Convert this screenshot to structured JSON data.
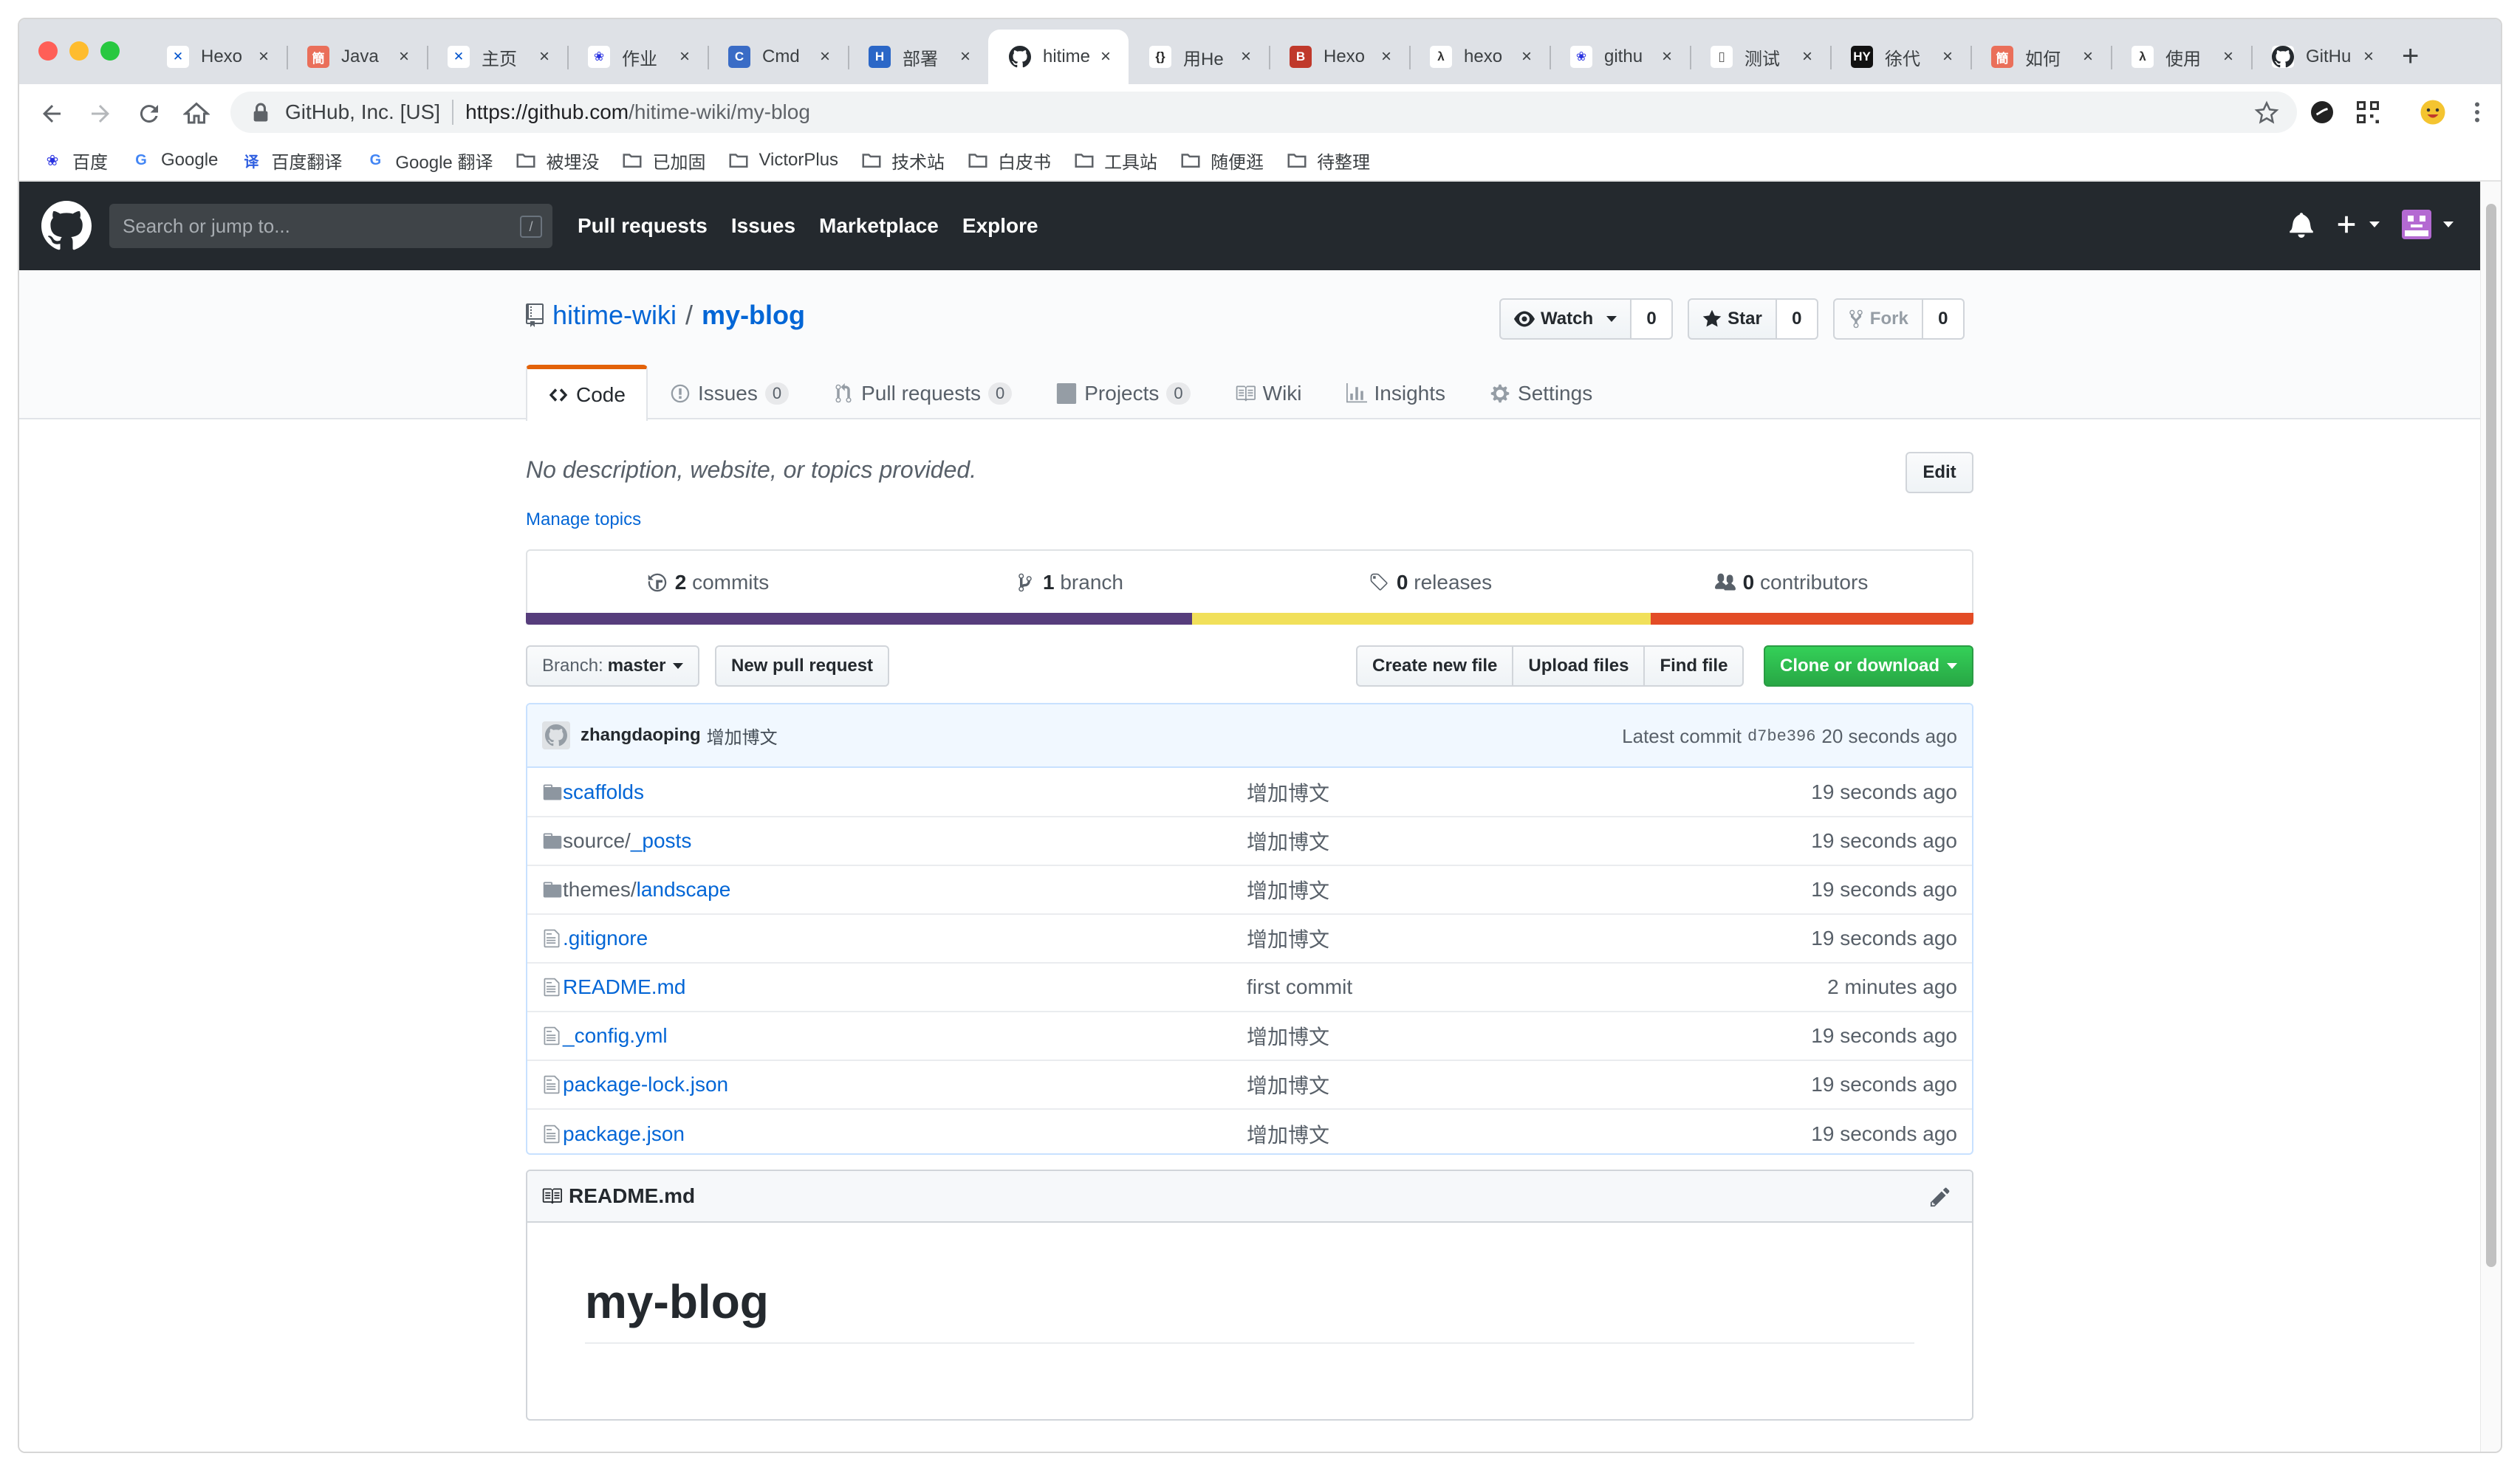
{
  "browser": {
    "tabs": [
      {
        "title": "Hexo",
        "favicon": "confluence-icon",
        "bg": "#ffffff",
        "fg": "#0052cc",
        "glyph": "✕"
      },
      {
        "title": "Java",
        "favicon": "jianshu-icon",
        "bg": "#ea6f5a",
        "fg": "#ffffff",
        "glyph": "簡"
      },
      {
        "title": "主页",
        "favicon": "confluence-icon",
        "bg": "#ffffff",
        "fg": "#0052cc",
        "glyph": "✕"
      },
      {
        "title": "作业",
        "favicon": "baidu-paw-icon",
        "bg": "#ffffff",
        "fg": "#2932e1",
        "glyph": "❀"
      },
      {
        "title": "Cmd",
        "favicon": "cmd-icon",
        "bg": "#3a6cc6",
        "fg": "#ffffff",
        "glyph": "C"
      },
      {
        "title": "部署",
        "favicon": "hexo-h-icon",
        "bg": "#2b67c7",
        "fg": "#ffffff",
        "glyph": "H"
      },
      {
        "title": "hitime",
        "favicon": "github-icon",
        "bg": "#ffffff",
        "fg": "#24292e",
        "glyph": "●",
        "active": true
      },
      {
        "title": "用He",
        "favicon": "bracket-icon",
        "bg": "#ffffff",
        "fg": "#222222",
        "glyph": "{}"
      },
      {
        "title": "Hexo",
        "favicon": "bilibili-b-icon",
        "bg": "#c0392b",
        "fg": "#ffffff",
        "glyph": "B"
      },
      {
        "title": "hexo",
        "favicon": "lambda-icon",
        "bg": "#ffffff",
        "fg": "#333333",
        "glyph": "λ"
      },
      {
        "title": "githu",
        "favicon": "baidu-paw-icon",
        "bg": "#ffffff",
        "fg": "#2932e1",
        "glyph": "❀"
      },
      {
        "title": "测试",
        "favicon": "doc-icon",
        "bg": "#ffffff",
        "fg": "#555555",
        "glyph": "▯"
      },
      {
        "title": "徐代",
        "favicon": "hy-icon",
        "bg": "#111111",
        "fg": "#ffffff",
        "glyph": "HY"
      },
      {
        "title": "如何",
        "favicon": "jianshu-icon",
        "bg": "#ea6f5a",
        "fg": "#ffffff",
        "glyph": "簡"
      },
      {
        "title": "使用",
        "favicon": "lambda-icon",
        "bg": "#ffffff",
        "fg": "#333333",
        "glyph": "λ"
      },
      {
        "title": "GitHu",
        "favicon": "github-icon",
        "bg": "#ffffff",
        "fg": "#24292e",
        "glyph": "●"
      }
    ],
    "new_tab": "+",
    "site_identity": "GitHub, Inc. [US]",
    "url_host": "https://github.com",
    "url_path": "/hitime-wiki/my-blog",
    "bookmarks": [
      {
        "label": "百度",
        "icon": "baidu-paw-icon",
        "glyph": "❀",
        "color": "#2932e1"
      },
      {
        "label": "Google",
        "icon": "google-g-icon",
        "glyph": "G",
        "color": "#4285f4"
      },
      {
        "label": "百度翻译",
        "icon": "baidu-translate-icon",
        "glyph": "译",
        "color": "#2f5fe0"
      },
      {
        "label": "Google 翻译",
        "icon": "google-translate-icon",
        "glyph": "G",
        "color": "#4285f4"
      },
      {
        "label": "被埋没",
        "icon": "folder-icon"
      },
      {
        "label": "已加固",
        "icon": "folder-icon"
      },
      {
        "label": "VictorPlus",
        "icon": "folder-icon"
      },
      {
        "label": "技术站",
        "icon": "folder-icon"
      },
      {
        "label": "白皮书",
        "icon": "folder-icon"
      },
      {
        "label": "工具站",
        "icon": "folder-icon"
      },
      {
        "label": "随便逛",
        "icon": "folder-icon"
      },
      {
        "label": "待整理",
        "icon": "folder-icon"
      }
    ]
  },
  "github": {
    "search_placeholder": "Search or jump to...",
    "search_key": "/",
    "nav": [
      "Pull requests",
      "Issues",
      "Marketplace",
      "Explore"
    ],
    "repo": {
      "owner": "hitime-wiki",
      "separator": "/",
      "name": "my-blog",
      "watch_label": "Watch",
      "watch_count": "0",
      "star_label": "Star",
      "star_count": "0",
      "fork_label": "Fork",
      "fork_count": "0"
    },
    "tabs": [
      {
        "label": "Code",
        "icon": "code-icon",
        "selected": true
      },
      {
        "label": "Issues",
        "icon": "issue-icon",
        "count": "0"
      },
      {
        "label": "Pull requests",
        "icon": "pull-request-icon",
        "count": "0"
      },
      {
        "label": "Projects",
        "icon": "project-icon",
        "count": "0"
      },
      {
        "label": "Wiki",
        "icon": "book-icon"
      },
      {
        "label": "Insights",
        "icon": "graph-icon"
      },
      {
        "label": "Settings",
        "icon": "gear-icon"
      }
    ],
    "description": "No description, website, or topics provided.",
    "edit_label": "Edit",
    "manage_topics": "Manage topics",
    "summary": {
      "commits_count": "2",
      "commits_label": "commits",
      "branch_count": "1",
      "branch_label": "branch",
      "releases_count": "0",
      "releases_label": "releases",
      "contributors_count": "0",
      "contributors_label": "contributors"
    },
    "language_bar": [
      {
        "color": "#563d7c",
        "percent": 46
      },
      {
        "color": "#f1e05a",
        "percent": 31.7
      },
      {
        "color": "#e34c26",
        "percent": 22.3
      }
    ],
    "branch_label": "Branch:",
    "branch_name": "master",
    "new_pr": "New pull request",
    "file_buttons": [
      "Create new file",
      "Upload files",
      "Find file"
    ],
    "clone_label": "Clone or download",
    "commit": {
      "author": "zhangdaoping",
      "message": "增加博文",
      "latest_label": "Latest commit",
      "sha": "d7be396",
      "age": "20 seconds ago"
    },
    "files": [
      {
        "type": "dir",
        "prefix": "",
        "name": "scaffolds",
        "message": "增加博文",
        "age": "19 seconds ago"
      },
      {
        "type": "dir",
        "prefix": "source/",
        "name": "_posts",
        "message": "增加博文",
        "age": "19 seconds ago"
      },
      {
        "type": "dir",
        "prefix": "themes/",
        "name": "landscape",
        "message": "增加博文",
        "age": "19 seconds ago"
      },
      {
        "type": "file",
        "prefix": "",
        "name": ".gitignore",
        "message": "增加博文",
        "age": "19 seconds ago"
      },
      {
        "type": "file",
        "prefix": "",
        "name": "README.md",
        "message": "first commit",
        "age": "2 minutes ago"
      },
      {
        "type": "file",
        "prefix": "",
        "name": "_config.yml",
        "message": "增加博文",
        "age": "19 seconds ago"
      },
      {
        "type": "file",
        "prefix": "",
        "name": "package-lock.json",
        "message": "增加博文",
        "age": "19 seconds ago"
      },
      {
        "type": "file",
        "prefix": "",
        "name": "package.json",
        "message": "增加博文",
        "age": "19 seconds ago"
      }
    ],
    "readme": {
      "filename": "README.md",
      "heading": "my-blog"
    }
  }
}
